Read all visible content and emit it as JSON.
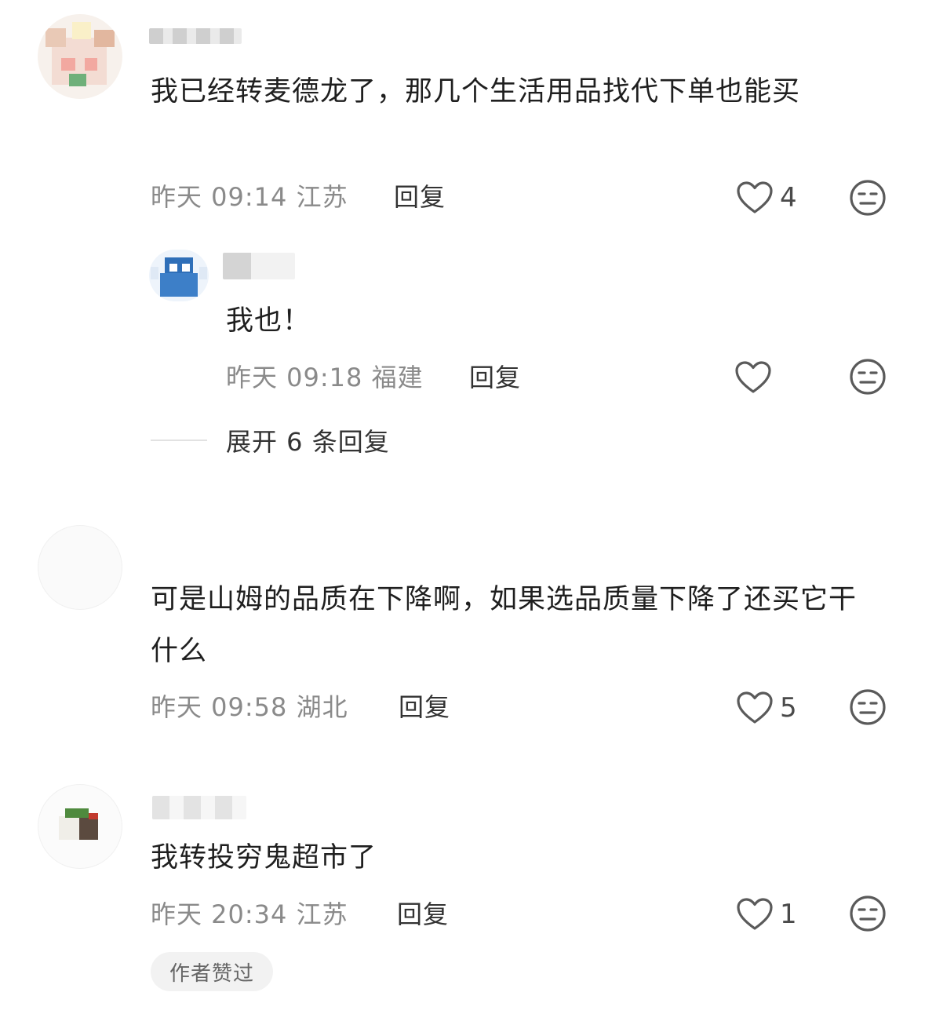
{
  "comments": [
    {
      "content": "我已经转麦德龙了，那几个生活用品找代下单也能买",
      "time": "昨天 09:14 江苏",
      "reply_label": "回复",
      "likes": "4"
    },
    {
      "content": "可是山姆的品质在下降啊，如果选品质量下降了还买它干什么",
      "time": "昨天 09:58 湖北",
      "reply_label": "回复",
      "likes": "5"
    },
    {
      "content": "我转投穷鬼超市了",
      "time": "昨天 20:34 江苏",
      "reply_label": "回复",
      "likes": "1",
      "badge": "作者赞过"
    }
  ],
  "sub_reply": {
    "content": "我也！",
    "time": "昨天 09:18 福建",
    "reply_label": "回复"
  },
  "expand_replies": "展开 6 条回复",
  "icons": {
    "like": "heart-outline-icon",
    "dislike": "neutral-face-icon"
  },
  "colors": {
    "text_primary": "#1f1f1f",
    "text_secondary": "#8a8a8a",
    "icon": "#5a5a5a"
  }
}
